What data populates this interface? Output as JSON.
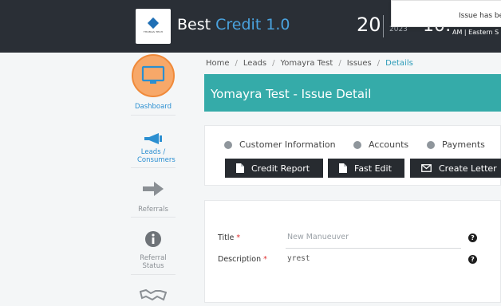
{
  "header": {
    "logo_text": "THOMAS TECH",
    "brand_prefix": "Best",
    "brand_accent": "Credit 1.0",
    "date_day": "20",
    "date_year": "2023",
    "time": "10:",
    "ampm_tz": "AM | Eastern S"
  },
  "toast": {
    "message": "Issue has be"
  },
  "sidebar": {
    "items": [
      {
        "label": "Dashboard",
        "icon": "monitor-icon"
      },
      {
        "label": "Leads / Consumers",
        "icon": "megaphone-icon"
      },
      {
        "label": "Referrals",
        "icon": "arrow-right-icon"
      },
      {
        "label": "Referral Status",
        "icon": "info-icon"
      },
      {
        "label": "",
        "icon": "handshake-icon"
      }
    ]
  },
  "breadcrumb": [
    "Home",
    "Leads",
    "Yomayra Test",
    "Issues",
    "Details"
  ],
  "page_title": "Yomayra Test - Issue Detail",
  "tabs": [
    "Customer Information",
    "Accounts",
    "Payments"
  ],
  "buttons": [
    {
      "label": "Credit Report",
      "icon": "file-icon"
    },
    {
      "label": "Fast Edit",
      "icon": "file-icon"
    },
    {
      "label": "Create Letter",
      "icon": "envelope-icon"
    }
  ],
  "form": {
    "title": {
      "label": "Title",
      "placeholder": "New Manueuver"
    },
    "description": {
      "label": "Description",
      "value": "yrest"
    },
    "required_mark": "*",
    "help_glyph": "?"
  },
  "colors": {
    "topbar": "#2a2f36",
    "accent_blue": "#4aa3df",
    "teal_header": "#35aba9",
    "dashboard_circle": "#f7a869",
    "button_dark": "#272b30"
  }
}
